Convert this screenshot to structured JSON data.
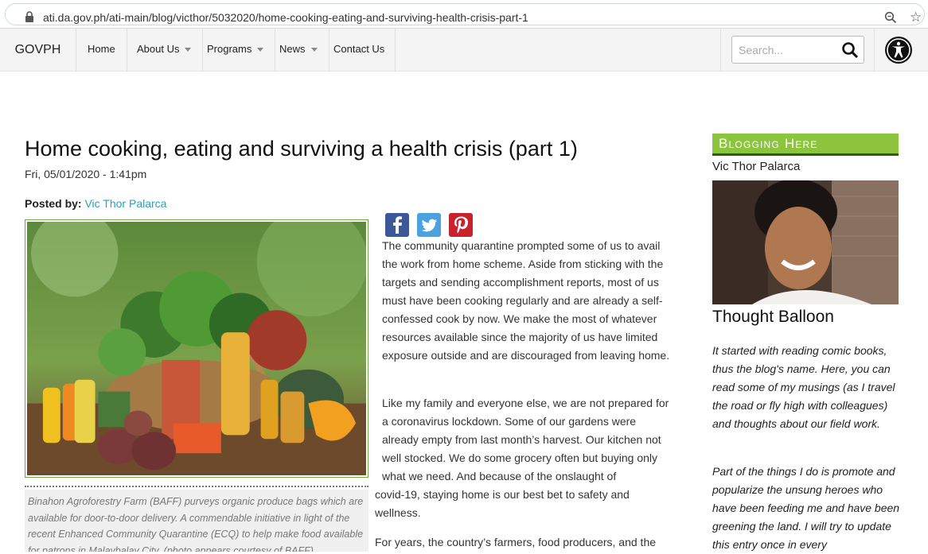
{
  "browser": {
    "url": "ati.da.gov.ph/ati-main/blog/victhor/5032020/home-cooking-eating-and-surviving-health-crisis-part-1"
  },
  "nav": {
    "brand": "GOVPH",
    "items": [
      {
        "label": "Home"
      },
      {
        "label": "About Us"
      },
      {
        "label": "Programs"
      },
      {
        "label": "News"
      },
      {
        "label": "Contact Us"
      }
    ],
    "search_placeholder": "Search..."
  },
  "article": {
    "title": "Home cooking, eating and surviving a health crisis (part 1)",
    "date": "Fri, 05/01/2020 - 1:41pm",
    "posted_label": "Posted by:",
    "author": "Vic Thor Palarca",
    "caption": "Binahon Agroforestry Farm (BAFF) purveys organic produce bags which are available for door-to-door delivery. A commendable initiative in light of the recent Enhanced Community Quarantine (ECQ) to help make food available for patrons in Malaybalay City. (photo appears courtesy of BAFF)",
    "paragraph1": "The community quarantine prompted some of us to avail the work from home scheme. Aside from sticking with the targets and sending accomplishment reports, most of us must have been cooking regularly and are already a self-confessed cook by now. We make the most of whatever resources available since the majority of us have limited exposure outside and are discouraged from leaving home.",
    "paragraph2": "Like my family and everyone else, we are not prepared for a coronavirus lockdown. Some of our gardens were already empty from last month’s harvest. Our kitchen not well stocked. We do some grocery often but buying only what we need. And because of the onslaught of",
    "paragraph2_cont": "covid-19, staying home is our best bet to safety and wellness.",
    "paragraph3": "For years, the country’s farmers, food producers, and the"
  },
  "sidebar": {
    "heading": "Blogging Here",
    "name": "Vic Thor Palarca",
    "blog_title": "Thought Balloon",
    "text1": "It started with reading comic books, thus the blog's name. Here, you can read some of my musings (as I travel the road or fly high with colleagues) and thoughts about our field work.",
    "text2": "Part of the things I do is promote and popularize the unsung heroes who have been feeding me and have been greening the land. I will try to update this entry once in every"
  }
}
